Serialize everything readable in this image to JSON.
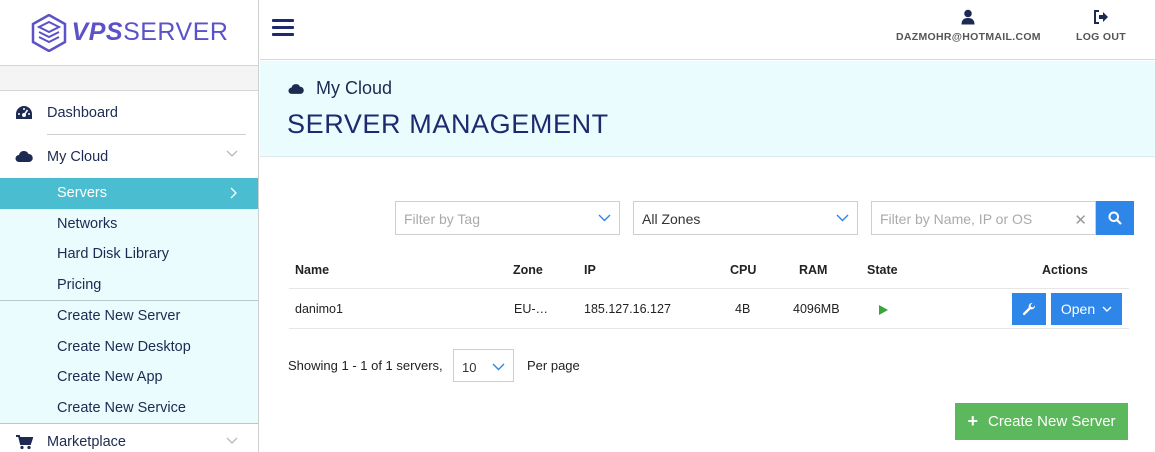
{
  "brand": {
    "bold": "VPS",
    "light": "SERVER"
  },
  "colors": {
    "accent": "#2e86e8",
    "brand": "#5b52c9",
    "active_nav": "#4bbdd0",
    "success": "#5cb85c",
    "light_band": "#eafcfd"
  },
  "sidebar": {
    "items": [
      {
        "label": "Dashboard",
        "icon": "dashboard-icon"
      },
      {
        "label": "My Cloud",
        "icon": "cloud-icon"
      },
      {
        "label": "Marketplace",
        "icon": "cart-icon"
      }
    ],
    "cloud_sub": [
      {
        "label": "Servers",
        "active": true
      },
      {
        "label": "Networks"
      },
      {
        "label": "Hard Disk Library"
      },
      {
        "label": "Pricing"
      }
    ],
    "create_sub": [
      {
        "label": "Create New Server"
      },
      {
        "label": "Create New Desktop"
      },
      {
        "label": "Create New App"
      },
      {
        "label": "Create New Service"
      }
    ]
  },
  "topbar": {
    "user_email": "DAZMOHR@HOTMAIL.COM",
    "logout_label": "LOG OUT"
  },
  "header": {
    "breadcrumb": "My Cloud",
    "title": "SERVER MANAGEMENT"
  },
  "filters": {
    "tag_placeholder": "Filter by Tag",
    "zone_value": "All Zones",
    "search_placeholder": "Filter by Name, IP or OS"
  },
  "table": {
    "columns": [
      "Name",
      "Zone",
      "IP",
      "CPU",
      "RAM",
      "State",
      "Actions"
    ],
    "rows": [
      {
        "name": "danimo1",
        "zone": "EU-…",
        "ip": "185.127.16.127",
        "cpu": "4B",
        "ram": "4096MB",
        "state": "running",
        "open_label": "Open"
      }
    ]
  },
  "pagination": {
    "showing": "Showing 1 - 1 of 1 servers,",
    "per_page_value": "10",
    "per_page_label": "Per page"
  },
  "create_button": "Create New Server"
}
